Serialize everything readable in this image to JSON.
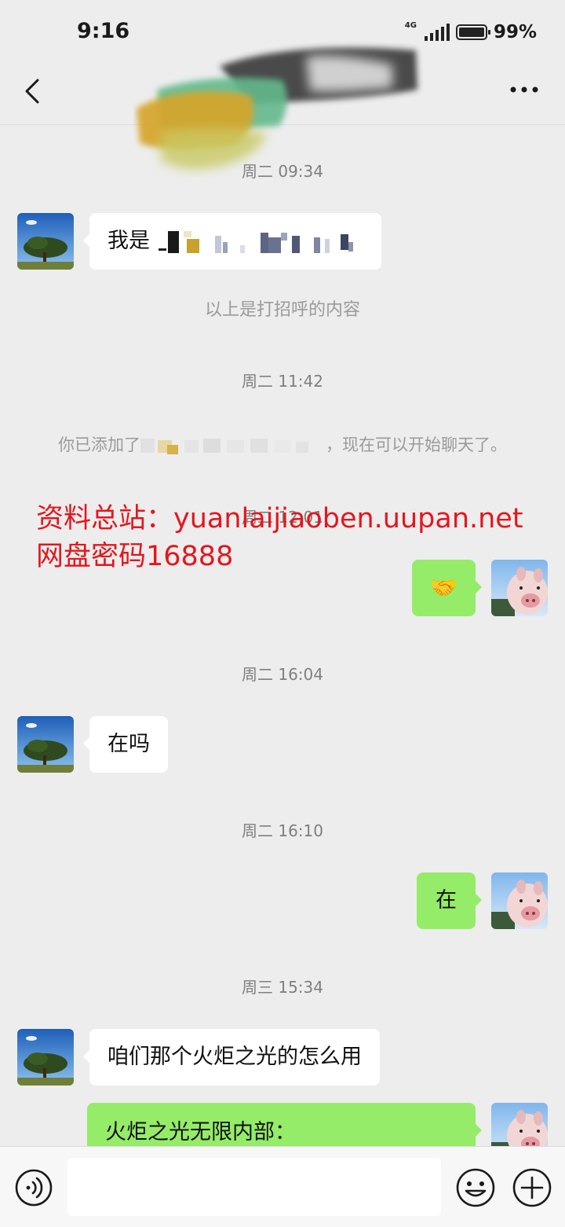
{
  "status_bar": {
    "time": "9:16",
    "network": "4G",
    "battery": "99%",
    "battery_level": 0.99
  },
  "nav": {
    "back_icon": "chevron-left-icon",
    "more_icon": "more-dots-icon"
  },
  "messages": {
    "ts1": "周二 09:34",
    "m1_prefix": "我是",
    "greeting_note": "以上是打招呼的内容",
    "ts2": "周二 11:42",
    "added_note_prefix": "你已添加了",
    "added_note_suffix": "，现在可以开始聊天了。",
    "ts3": "周二 12:01",
    "m2_emoji": "🤝",
    "ts4": "周二 16:04",
    "m3": "在吗",
    "ts5": "周二 16:10",
    "m4": "在",
    "ts6": "周三 15:34",
    "m5": "咱们那个火炬之光的怎么用",
    "m6": "火炬之光无限内部："
  },
  "watermark": {
    "line1": "资料总站：yuanlaijiaoben.uupan.net",
    "line2": "网盘密码16888"
  },
  "input_bar": {
    "voice_icon": "voice-icon",
    "emoji_icon": "emoji-icon",
    "plus_icon": "plus-icon",
    "placeholder": ""
  },
  "colors": {
    "background": "#ededed",
    "bubble_sent": "#95ec69",
    "bubble_received": "#ffffff",
    "watermark": "#e4161d"
  }
}
